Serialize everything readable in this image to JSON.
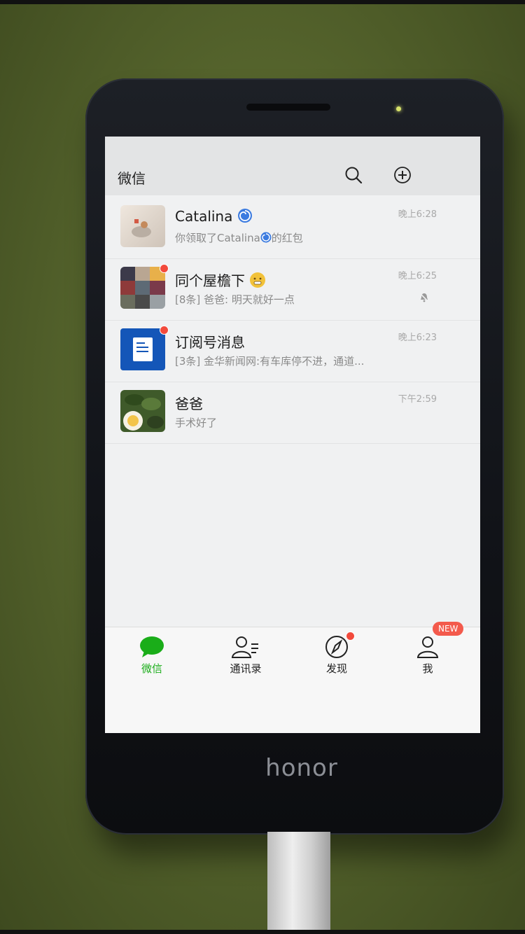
{
  "device": {
    "brand": "honor"
  },
  "header": {
    "title": "微信",
    "icons": [
      "search-icon",
      "add-icon"
    ]
  },
  "chats": [
    {
      "name": "Catalina",
      "name_icon": "swirl-icon",
      "preview": "你领取了Catalina",
      "preview_suffix": "的红包",
      "time": "晚上6:28",
      "unread_dot": false,
      "muted": false
    },
    {
      "name": "同个屋檐下",
      "name_icon": "emoji-icon",
      "preview": "[8条] 爸爸: 明天就好一点",
      "time": "晚上6:25",
      "unread_dot": true,
      "muted": true
    },
    {
      "name": "订阅号消息",
      "preview": "[3条] 金华新闻网:有车库停不进，通道...",
      "time": "晚上6:23",
      "unread_dot": true,
      "muted": false
    },
    {
      "name": "爸爸",
      "preview": "手术好了",
      "time": "下午2:59",
      "unread_dot": false,
      "muted": false
    }
  ],
  "tabs": [
    {
      "label": "微信",
      "icon": "chat-bubble-icon",
      "active": true
    },
    {
      "label": "通讯录",
      "icon": "contacts-icon",
      "active": false
    },
    {
      "label": "发现",
      "icon": "compass-icon",
      "active": false,
      "dot": true
    },
    {
      "label": "我",
      "icon": "profile-icon",
      "active": false,
      "badge": "NEW"
    }
  ],
  "colors": {
    "accent": "#1aad19",
    "badge": "#f35a4c",
    "subscription": "#1456b8"
  }
}
